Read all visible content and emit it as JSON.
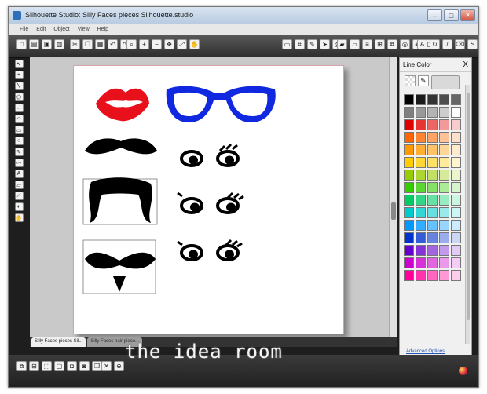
{
  "window": {
    "title": "Silhouette Studio: Silly Faces pieces Silhouette.studio",
    "minimize": "–",
    "maximize": "□",
    "close": "✕"
  },
  "menu": [
    "File",
    "Edit",
    "Object",
    "View",
    "Help"
  ],
  "palette": {
    "title": "Line Color",
    "close": "X",
    "advanced_label": "Advanced Options",
    "colors": [
      "#000000",
      "#1a1a1a",
      "#333333",
      "#4d4d4d",
      "#666666",
      "#808080",
      "#999999",
      "#b3b3b3",
      "#cccccc",
      "#ffffff",
      "#e00000",
      "#e63333",
      "#ec6666",
      "#f29999",
      "#f8cccc",
      "#ff6600",
      "#ff8533",
      "#ffa366",
      "#ffc299",
      "#ffe0cc",
      "#ff9900",
      "#ffad33",
      "#ffc266",
      "#ffd699",
      "#ffebcc",
      "#ffcc00",
      "#ffd633",
      "#ffe066",
      "#ffeb99",
      "#fff5cc",
      "#99cc00",
      "#add633",
      "#c2e066",
      "#d6eb99",
      "#ebf5cc",
      "#33cc00",
      "#5cd633",
      "#85e066",
      "#adeb99",
      "#d6f5cc",
      "#00cc66",
      "#33d685",
      "#66e0a3",
      "#99ebc2",
      "#ccf5e0",
      "#00cccc",
      "#33d6d6",
      "#66e0e0",
      "#99ebeb",
      "#ccf5f5",
      "#0099ff",
      "#33adff",
      "#66c2ff",
      "#99d6ff",
      "#ccebff",
      "#0033cc",
      "#335cd6",
      "#6685e0",
      "#99adeb",
      "#ccd6f5",
      "#6600cc",
      "#8533d6",
      "#a366e0",
      "#c299eb",
      "#e0ccf5",
      "#cc00cc",
      "#d633d6",
      "#e066e0",
      "#eb99eb",
      "#f5ccf5",
      "#ff0099",
      "#ff33ad",
      "#ff66c2",
      "#ff99d6",
      "#ffcceb"
    ]
  },
  "tabs": {
    "active": "Silly Faces pieces Sil...",
    "inactive": "Silly Faces hair piece..."
  },
  "watermark": "the idea room",
  "shape_colors": {
    "lips": "#e8101a",
    "glasses": "#1028e0",
    "black": "#000000"
  }
}
